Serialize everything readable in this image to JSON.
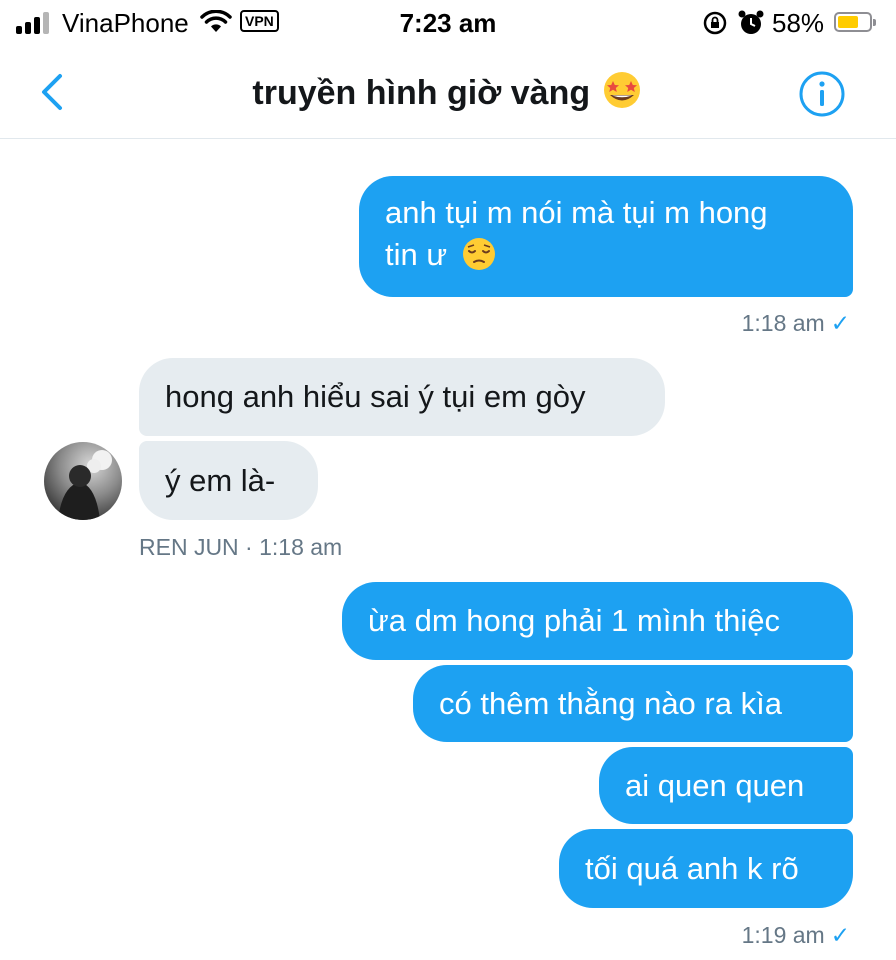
{
  "status_bar": {
    "carrier": "VinaPhone",
    "vpn": "VPN",
    "time": "7:23 am",
    "battery": "58%",
    "battery_level": 0.58
  },
  "header": {
    "title": "truyền hình giờ vàng",
    "title_emoji": "star-struck",
    "back_icon": "chevron-left-icon",
    "info_icon": "info-icon"
  },
  "messages": [
    {
      "direction": "outgoing",
      "lines": [
        "anh tụi m nói mà tụi m hong",
        "tin ư"
      ],
      "emoji": "pensive"
    },
    {
      "direction": "incoming",
      "text": "hong anh hiểu sai ý tụi em gòy"
    },
    {
      "direction": "incoming",
      "text": "ý em là-"
    },
    {
      "direction": "outgoing",
      "text": "ừa dm hong phải 1 mình thiệc"
    },
    {
      "direction": "outgoing",
      "text": "có thêm thằng nào ra kìa"
    },
    {
      "direction": "outgoing",
      "text": "ai quen quen"
    },
    {
      "direction": "outgoing",
      "text": "tối quá anh k rõ"
    }
  ],
  "meta": {
    "first_outgoing_time": "1:18 am",
    "incoming_sender_time": "REN JUN · 1:18 am",
    "last_outgoing_time": "1:19 am",
    "read_mark": "✓"
  },
  "colors": {
    "accent": "#1da1f2",
    "incoming_bubble": "#e6ecf0",
    "meta_text": "#657786",
    "battery": "#ffcc00"
  }
}
